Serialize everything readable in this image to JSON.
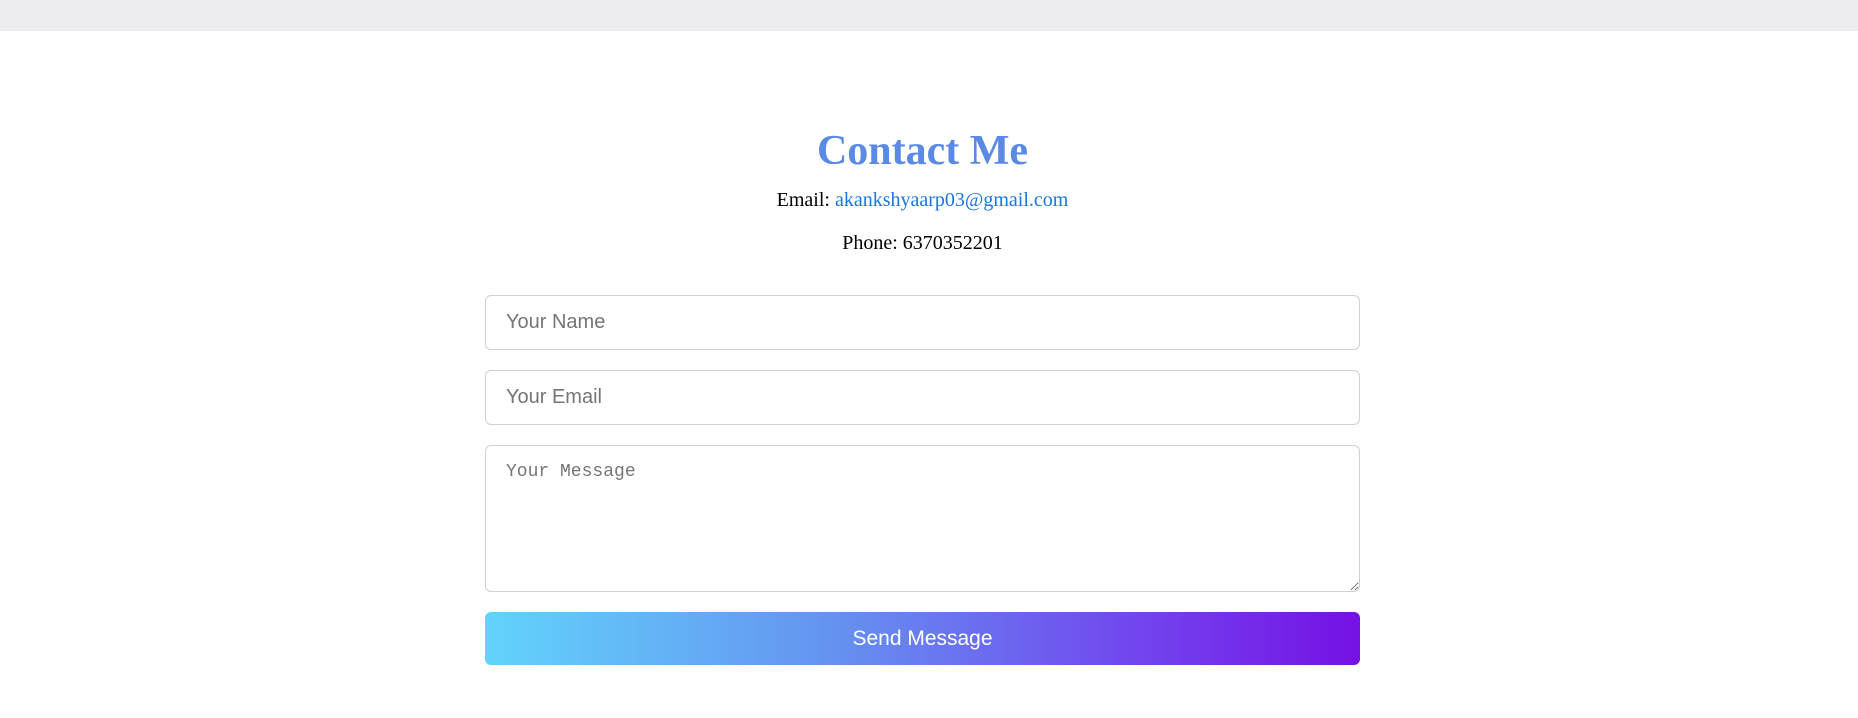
{
  "contact": {
    "title": "Contact Me",
    "email_label": "Email:",
    "email_value": "akankshyaarp03@gmail.com",
    "phone_label": "Phone:",
    "phone_value": "6370352201"
  },
  "form": {
    "name_placeholder": "Your Name",
    "email_placeholder": "Your Email",
    "message_placeholder": "Your Message",
    "submit_label": "Send Message"
  },
  "colors": {
    "title": "#5a8ae6",
    "link": "#1a76e0",
    "button_gradient_start": "#62d3fb",
    "button_gradient_end": "#7511e4",
    "top_strip": "#ededf0"
  }
}
